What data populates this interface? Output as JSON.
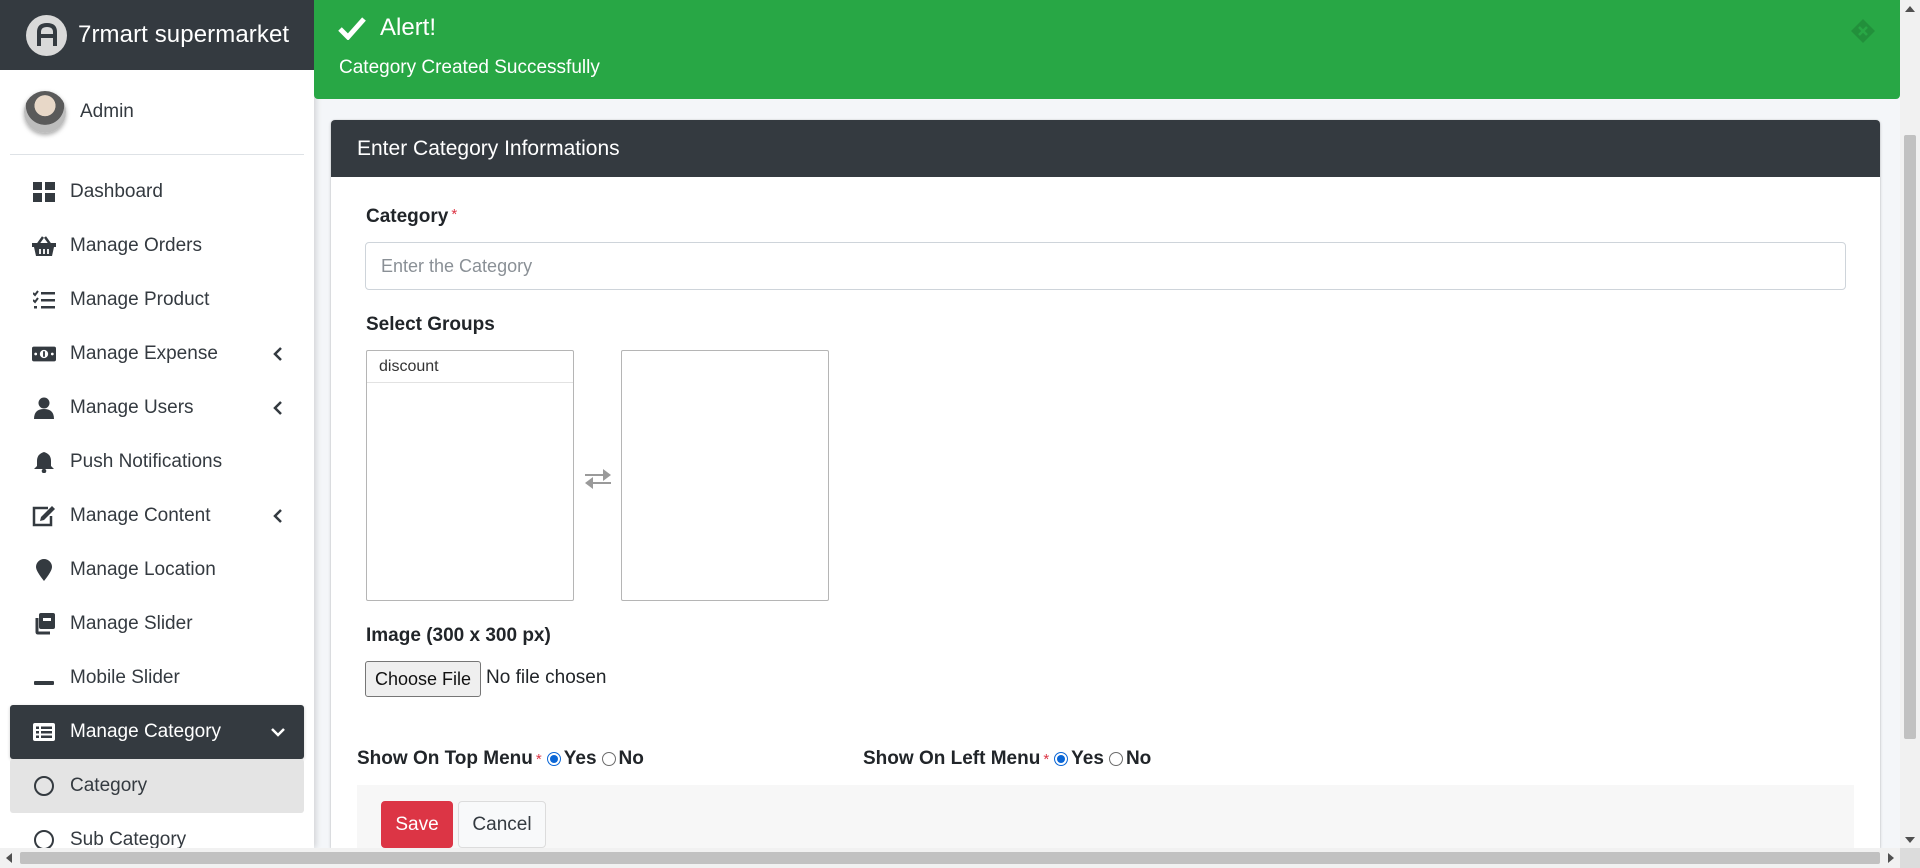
{
  "brand": {
    "name": "7rmart supermarket"
  },
  "user": {
    "name": "Admin"
  },
  "sidebar": {
    "items": [
      {
        "label": "Dashboard",
        "icon": "dashboard-icon"
      },
      {
        "label": "Manage Orders",
        "icon": "basket-icon"
      },
      {
        "label": "Manage Product",
        "icon": "tasks-icon"
      },
      {
        "label": "Manage Expense",
        "icon": "money-icon",
        "has_caret": true
      },
      {
        "label": "Manage Users",
        "icon": "user-icon",
        "has_caret": true
      },
      {
        "label": "Push Notifications",
        "icon": "bell-icon"
      },
      {
        "label": "Manage Content",
        "icon": "edit-icon",
        "has_caret": true
      },
      {
        "label": "Manage Location",
        "icon": "map-marker-icon"
      },
      {
        "label": "Manage Slider",
        "icon": "clone-icon"
      },
      {
        "label": "Mobile Slider",
        "icon": "minus-icon"
      },
      {
        "label": "Manage Category",
        "icon": "list-icon",
        "expanded": true
      },
      {
        "label": "Category",
        "icon": "circle-icon"
      },
      {
        "label": "Sub Category",
        "icon": "circle-icon"
      }
    ]
  },
  "alert": {
    "title": "Alert!",
    "message": "Category Created Successfully",
    "color": "#28a745"
  },
  "form": {
    "header": "Enter Category Informations",
    "category_label": "Category",
    "required_mark": "*",
    "category_placeholder": "Enter the Category",
    "category_value": "",
    "groups_label": "Select Groups",
    "groups_available": [
      "discount"
    ],
    "groups_selected": [],
    "image_label": "Image (300 x 300 px)",
    "file_button": "Choose File",
    "file_status": "No file chosen",
    "top_menu_label": "Show On Top Menu",
    "left_menu_label": "Show On Left Menu",
    "yes_label": "Yes",
    "no_label": "No",
    "top_menu_value": "Yes",
    "left_menu_value": "Yes"
  },
  "actions": {
    "save_label": "Save",
    "cancel_label": "Cancel",
    "save_color": "#dc3545"
  },
  "theme": {
    "dark": "#343a40",
    "accent_blue": "#0a66d6"
  }
}
